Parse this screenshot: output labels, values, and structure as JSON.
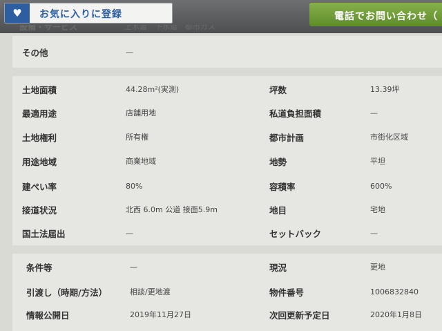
{
  "header": {
    "favorite_label": "お気に入りに登録",
    "call_label": "電話でお問い合わせ（"
  },
  "cut_row": {
    "label": "設備・サービス",
    "value": "上水道　下水道　都市ガス"
  },
  "other": {
    "label": "その他",
    "value": "—"
  },
  "land_rows": [
    {
      "l1": "土地面積",
      "v1": "44.28m²(実測)",
      "l2": "坪数",
      "v2": "13.39坪"
    },
    {
      "l1": "最適用途",
      "v1": "店舗用地",
      "l2": "私道負担面積",
      "v2": "—"
    },
    {
      "l1": "土地権利",
      "v1": "所有権",
      "l2": "都市計画",
      "v2": "市街化区域"
    },
    {
      "l1": "用途地域",
      "v1": "商業地域",
      "l2": "地勢",
      "v2": "平坦"
    },
    {
      "l1": "建ぺい率",
      "v1": "80%",
      "l2": "容積率",
      "v2": "600%"
    },
    {
      "l1": "接道状況",
      "v1": "北西 6.0m 公道 接面5.9m",
      "l2": "地目",
      "v2": "宅地"
    },
    {
      "l1": "国土法届出",
      "v1": "—",
      "l2": "セットバック",
      "v2": "—"
    }
  ],
  "cond_rows": [
    {
      "l1": "条件等",
      "v1": "—",
      "l2": "現況",
      "v2": "更地"
    },
    {
      "l1": "引渡し（時期/方法）",
      "v1": "相談/更地渡",
      "l2": "物件番号",
      "v2": "1006832840"
    },
    {
      "l1": "情報公開日",
      "v1": "2019年11月27日",
      "l2": "次回更新予定日",
      "v2": "2020年1月8日"
    }
  ]
}
